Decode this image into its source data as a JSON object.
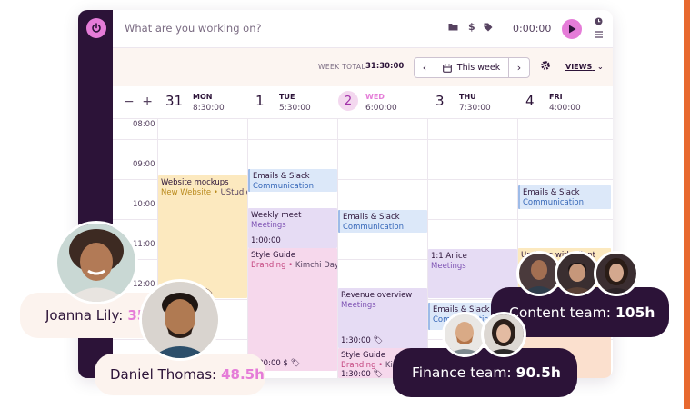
{
  "timer": {
    "placeholder": "What are you working on?",
    "time": "0:00:00",
    "icons": [
      "folder-icon",
      "dollar-icon",
      "tag-icon",
      "play-icon",
      "clock-icon",
      "list-icon"
    ]
  },
  "week_bar": {
    "total_label": "WEEK TOTAL",
    "total_value": "31:30:00",
    "this_week": "This week",
    "views": "VIEWS"
  },
  "days": [
    {
      "num": "31",
      "name": "MON",
      "total": "8:30:00",
      "today": false
    },
    {
      "num": "1",
      "name": "TUE",
      "total": "5:30:00",
      "today": false
    },
    {
      "num": "2",
      "name": "WED",
      "total": "6:00:00",
      "today": true
    },
    {
      "num": "3",
      "name": "THU",
      "total": "7:30:00",
      "today": false
    },
    {
      "num": "4",
      "name": "FRI",
      "total": "4:00:00",
      "today": false
    }
  ],
  "hours": [
    "08:00",
    "09:00",
    "10:00",
    "11:00",
    "12:00"
  ],
  "entries": [
    {
      "title": "Website mockups",
      "project": "New Website",
      "client": "UStudio",
      "duration": "",
      "color": "yellow"
    },
    {
      "title": "Emails & Slack",
      "project": "Communication",
      "client": "",
      "duration": "",
      "color": "blue"
    },
    {
      "title": "Weekly meet",
      "project": "Meetings",
      "client": "",
      "duration": "1:00:00",
      "color": "purple"
    },
    {
      "title": "Style Guide",
      "project": "Branding",
      "client": "Kimchi Day",
      "duration": "1:30:00",
      "color": "pink"
    },
    {
      "title": "Emails & Slack",
      "project": "Communication",
      "client": "",
      "duration": "",
      "color": "blue"
    },
    {
      "title": "Revenue overview",
      "project": "Meetings",
      "client": "",
      "duration": "1:30:00",
      "color": "purple"
    },
    {
      "title": "Style Guide",
      "project": "Branding",
      "client": "Kim",
      "duration": "1:30:00",
      "color": "pink"
    },
    {
      "title": "1:1 Anice",
      "project": "Meetings",
      "client": "",
      "duration": "",
      "color": "purple"
    },
    {
      "title": "Emails & Slack",
      "project": "Communication",
      "client": "",
      "duration": "",
      "color": "blue"
    },
    {
      "title": "Emails & Slack",
      "project": "Communication",
      "client": "",
      "duration": "",
      "color": "blue"
    },
    {
      "title": "Updates with client",
      "project": "",
      "client": "",
      "duration": "",
      "color": "yellow"
    }
  ],
  "overlays": {
    "joanna": {
      "name": "Joanna Lily:",
      "hours": "35"
    },
    "daniel": {
      "name": "Daniel Thomas:",
      "hours": "48.5h"
    },
    "content": {
      "name": "Content team:",
      "hours": "105h"
    },
    "finance": {
      "name": "Finance team:",
      "hours": "90.5h"
    }
  },
  "colors": {
    "brand_dark": "#2c1338",
    "accent_pink": "#e57cd8",
    "accent_orange": "#e8692f"
  }
}
